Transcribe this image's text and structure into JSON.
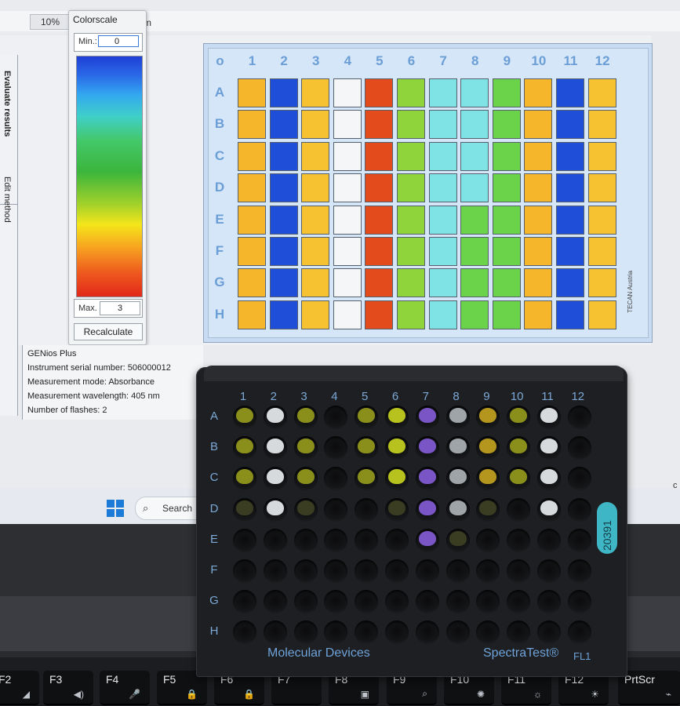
{
  "toolbar": {
    "zoom": "10%",
    "unit_fragment": "m"
  },
  "sidebar": {
    "tab1": "Evaluate results",
    "tab2": "Edit method"
  },
  "colorscale": {
    "title": "Colorscale",
    "min_label": "Min.:",
    "min_value": "0",
    "max_label": "Max.",
    "max_value": "3",
    "recalculate_label": "Recalculate"
  },
  "plate_view": {
    "corner": "o",
    "columns": [
      "1",
      "2",
      "3",
      "4",
      "5",
      "6",
      "7",
      "8",
      "9",
      "10",
      "11",
      "12"
    ],
    "rows": [
      "A",
      "B",
      "C",
      "D",
      "E",
      "F",
      "G",
      "H"
    ],
    "brand": "TECAN Austria",
    "well_colors": {
      "orange": "#f6b62c",
      "blue": "#1f4fd8",
      "yellow": "#f7c232",
      "white": "#f4f6f8",
      "red": "#e34a1c",
      "green": "#8fd43a",
      "cyan": "#7fe3e6",
      "midgreen": "#6bd34a"
    },
    "grid": [
      [
        "orange",
        "blue",
        "yellow",
        "white",
        "red",
        "green",
        "cyan",
        "cyan",
        "midgreen",
        "orange",
        "blue",
        "yellow"
      ],
      [
        "orange",
        "blue",
        "yellow",
        "white",
        "red",
        "green",
        "cyan",
        "cyan",
        "midgreen",
        "orange",
        "blue",
        "yellow"
      ],
      [
        "orange",
        "blue",
        "yellow",
        "white",
        "red",
        "green",
        "cyan",
        "cyan",
        "midgreen",
        "orange",
        "blue",
        "yellow"
      ],
      [
        "orange",
        "blue",
        "yellow",
        "white",
        "red",
        "green",
        "cyan",
        "cyan",
        "midgreen",
        "orange",
        "blue",
        "yellow"
      ],
      [
        "orange",
        "blue",
        "yellow",
        "white",
        "red",
        "green",
        "cyan",
        "midgreen",
        "midgreen",
        "orange",
        "blue",
        "yellow"
      ],
      [
        "orange",
        "blue",
        "yellow",
        "white",
        "red",
        "green",
        "cyan",
        "midgreen",
        "midgreen",
        "orange",
        "blue",
        "yellow"
      ],
      [
        "orange",
        "blue",
        "yellow",
        "white",
        "red",
        "green",
        "cyan",
        "midgreen",
        "midgreen",
        "orange",
        "blue",
        "yellow"
      ],
      [
        "orange",
        "blue",
        "yellow",
        "white",
        "red",
        "green",
        "cyan",
        "midgreen",
        "midgreen",
        "orange",
        "blue",
        "yellow"
      ]
    ]
  },
  "info": {
    "line1": "GENios Plus",
    "line2": "Instrument serial number: 506000012",
    "line3": "Measurement mode: Absorbance",
    "line4": "Measurement wavelength: 405 nm",
    "line5": "Number of flashes: 2"
  },
  "taskbar": {
    "search_label": "Search",
    "tray_char": "c"
  },
  "physical_plate": {
    "columns": [
      "1",
      "2",
      "3",
      "4",
      "5",
      "6",
      "7",
      "8",
      "9",
      "10",
      "11",
      "12"
    ],
    "rows": [
      "A",
      "B",
      "C",
      "D",
      "E",
      "F",
      "G",
      "H"
    ],
    "brand": "Molecular Devices",
    "product": "SpectraTest®",
    "model": "FL1",
    "label": "20391",
    "fill_colors": {
      "olive": "#8a8f1c",
      "white": "#d7dadd",
      "yellowgreen": "#b8c21f",
      "purple": "#7a55c6",
      "grey": "#9ea4a8",
      "gold": "#b4961e",
      "dim": "#3a3d22"
    },
    "filled": [
      [
        "olive",
        "white",
        "olive",
        "",
        "olive",
        "yellowgreen",
        "purple",
        "grey",
        "gold",
        "olive",
        "white",
        ""
      ],
      [
        "olive",
        "white",
        "olive",
        "",
        "olive",
        "yellowgreen",
        "purple",
        "grey",
        "gold",
        "olive",
        "white",
        ""
      ],
      [
        "olive",
        "white",
        "olive",
        "",
        "olive",
        "yellowgreen",
        "purple",
        "grey",
        "gold",
        "olive",
        "white",
        ""
      ],
      [
        "dim",
        "white",
        "dim",
        "",
        "",
        "dim",
        "purple",
        "grey",
        "dim",
        "",
        "white",
        ""
      ],
      [
        "",
        "",
        "",
        "",
        "",
        "",
        "purple",
        "dim",
        "",
        "",
        "",
        ""
      ],
      [
        "",
        "",
        "",
        "",
        "",
        "",
        "",
        "",
        "",
        "",
        "",
        ""
      ],
      [
        "",
        "",
        "",
        "",
        "",
        "",
        "",
        "",
        "",
        "",
        "",
        ""
      ],
      [
        "",
        "",
        "",
        "",
        "",
        "",
        "",
        "",
        "",
        "",
        "",
        ""
      ]
    ]
  },
  "keyboard": {
    "keys": [
      {
        "label": "F2",
        "icon": "◢"
      },
      {
        "label": "F3",
        "icon": "◀)"
      },
      {
        "label": "F4",
        "icon": "🎤"
      },
      {
        "label": "F5",
        "icon": "🔒"
      },
      {
        "label": "F6",
        "icon": "🔒"
      },
      {
        "label": "F7",
        "icon": ""
      },
      {
        "label": "F8",
        "icon": "▣"
      },
      {
        "label": "F9",
        "icon": "⌕"
      },
      {
        "label": "F10",
        "icon": "✺"
      },
      {
        "label": "F11",
        "icon": "☼"
      },
      {
        "label": "F12",
        "icon": "☀"
      },
      {
        "label": "PrtScr",
        "icon": "⌁"
      }
    ]
  }
}
